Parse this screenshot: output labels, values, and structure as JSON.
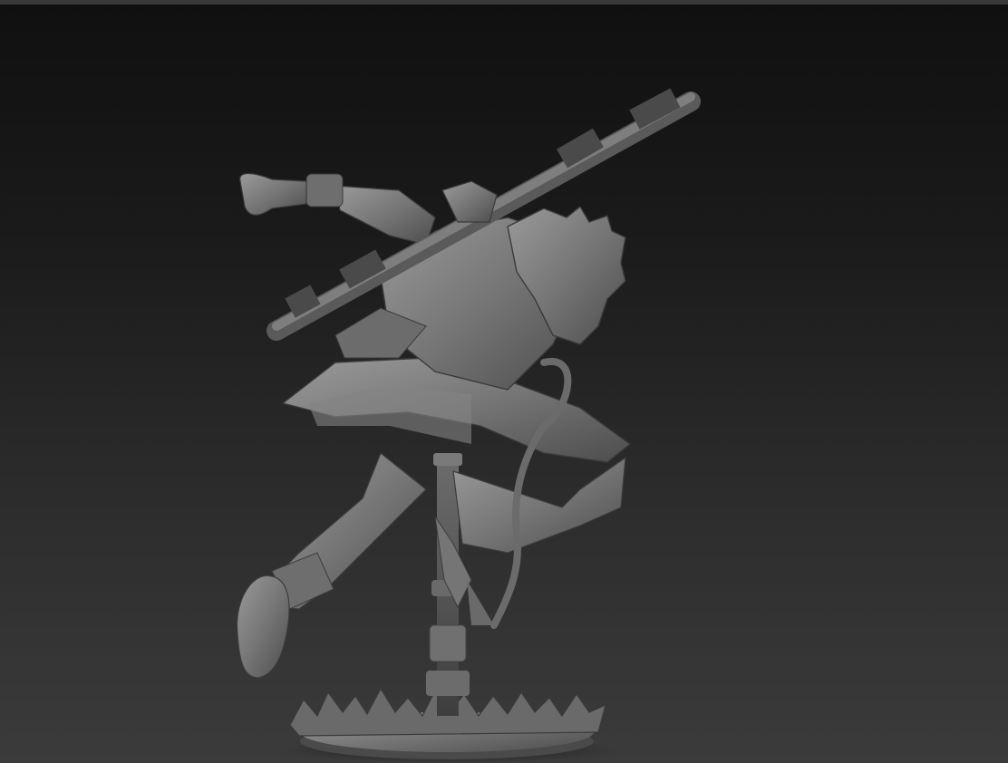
{
  "viewport": {
    "background_top": "#101010",
    "background_bottom": "#3b3b3b",
    "material_color": "#7b7b7b",
    "subject": "monkey-warrior-sculpt-with-staff"
  }
}
